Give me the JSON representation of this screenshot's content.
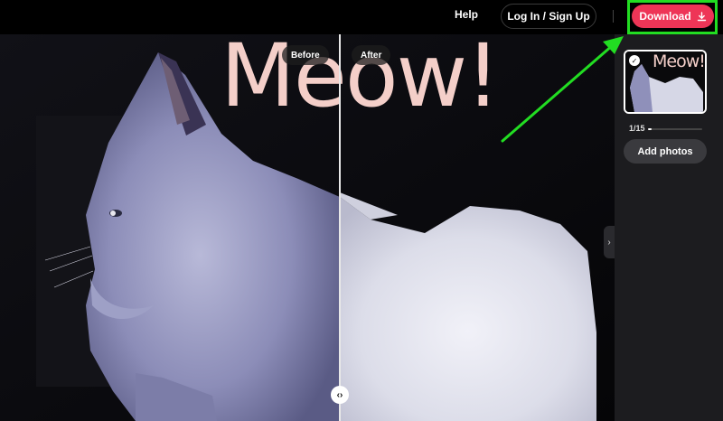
{
  "topbar": {
    "help_label": "Help",
    "login_label": "Log In / Sign Up",
    "download_label": "Download"
  },
  "canvas": {
    "overlay_text": "Meow!",
    "before_label": "Before",
    "after_label": "After",
    "split_handle_glyph": "‹›"
  },
  "sidebar": {
    "thumbnail_text": "Meow!",
    "counter": "1/15",
    "progress_fraction": 0.067,
    "add_photos_label": "Add photos"
  },
  "colors": {
    "accent": "#ee3557",
    "highlight": "#22dd22",
    "overlay_text": "#f4cfc9",
    "sidebar_bg": "#1c1c1f"
  },
  "icons": {
    "download": "download-icon",
    "collapse": "chevron-right-icon",
    "selected": "check-icon",
    "split_handle": "split-handle-icon"
  }
}
